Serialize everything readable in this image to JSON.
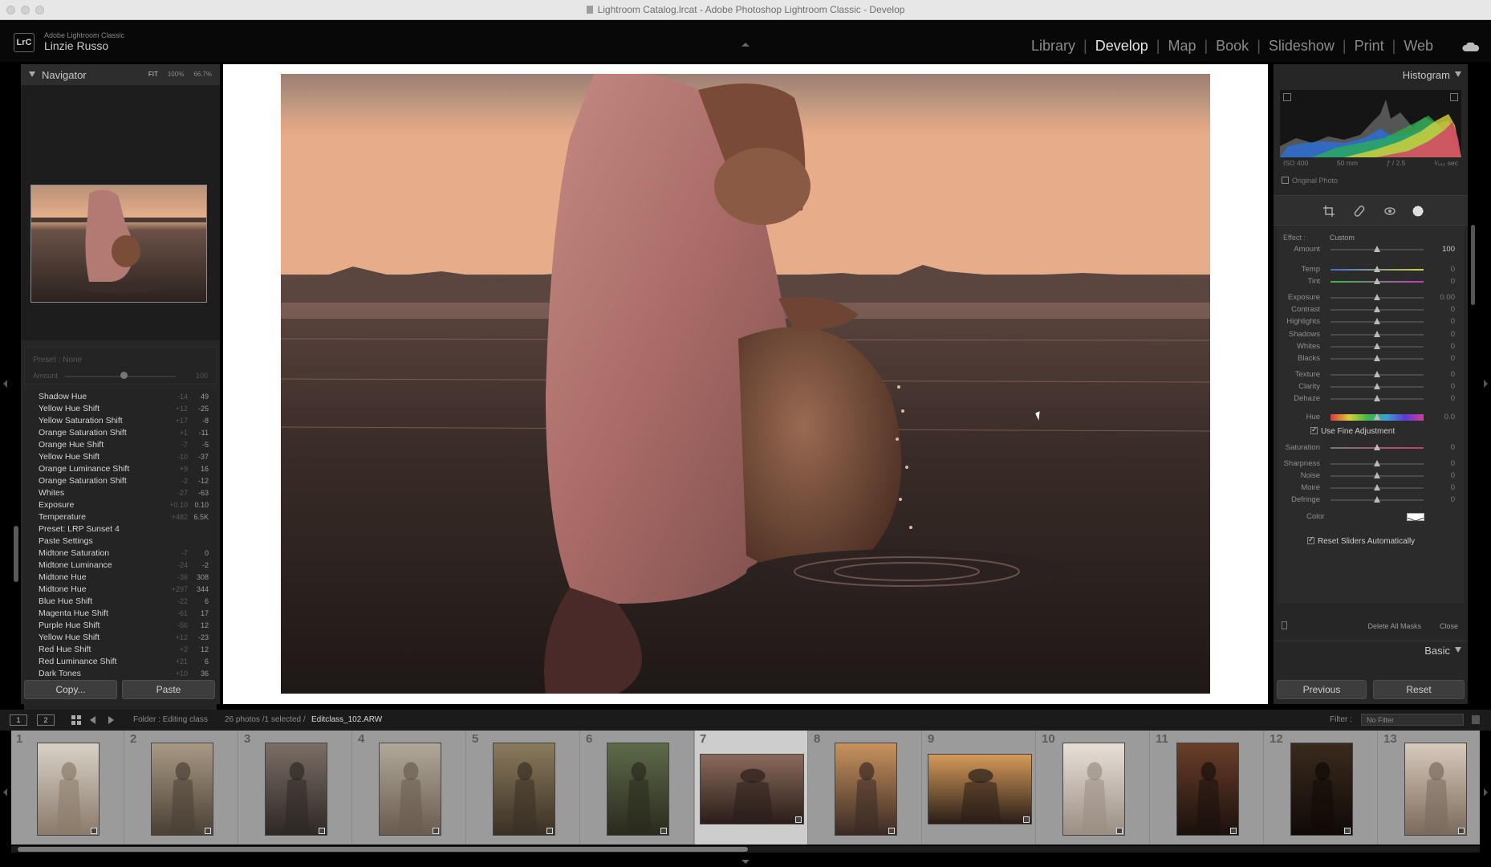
{
  "window": {
    "title": "Lightroom Catalog.lrcat - Adobe Photoshop Lightroom Classic - Develop"
  },
  "identity": {
    "logo": "LrC",
    "app_name": "Adobe Lightroom Classic",
    "user": "Linzie Russo"
  },
  "modules": [
    "Library",
    "Develop",
    "Map",
    "Book",
    "Slideshow",
    "Print",
    "Web"
  ],
  "active_module": "Develop",
  "navigator": {
    "title": "Navigator",
    "zoom_options": [
      "FIT",
      "100%",
      "66.7%"
    ],
    "active_zoom": "FIT"
  },
  "preset_box": {
    "name": "Preset : None",
    "amount_label": "Amount",
    "amount_value": "100"
  },
  "history": [
    {
      "label": "Shadow Hue",
      "delta": "-14",
      "value": "49"
    },
    {
      "label": "Yellow Hue Shift",
      "delta": "+12",
      "value": "-25"
    },
    {
      "label": "Yellow Saturation Shift",
      "delta": "+17",
      "value": "-8"
    },
    {
      "label": "Orange Saturation Shift",
      "delta": "+1",
      "value": "-11"
    },
    {
      "label": "Orange Hue Shift",
      "delta": "-7",
      "value": "-5"
    },
    {
      "label": "Yellow Hue Shift",
      "delta": "-10",
      "value": "-37"
    },
    {
      "label": "Orange Luminance Shift",
      "delta": "+9",
      "value": "16"
    },
    {
      "label": "Orange Saturation Shift",
      "delta": "-2",
      "value": "-12"
    },
    {
      "label": "Whites",
      "delta": "-27",
      "value": "-63"
    },
    {
      "label": "Exposure",
      "delta": "+0.10",
      "value": "0.10"
    },
    {
      "label": "Temperature",
      "delta": "+482",
      "value": "6.5K"
    },
    {
      "label": "Preset: LRP Sunset 4",
      "delta": "",
      "value": ""
    },
    {
      "label": "Paste Settings",
      "delta": "",
      "value": ""
    },
    {
      "label": "Midtone Saturation",
      "delta": "-7",
      "value": "0"
    },
    {
      "label": "Midtone Luminance",
      "delta": "-24",
      "value": "-2"
    },
    {
      "label": "Midtone Hue",
      "delta": "-36",
      "value": "308"
    },
    {
      "label": "Midtone Hue",
      "delta": "+297",
      "value": "344"
    },
    {
      "label": "Blue Hue Shift",
      "delta": "-22",
      "value": "6"
    },
    {
      "label": "Magenta Hue Shift",
      "delta": "-61",
      "value": "17"
    },
    {
      "label": "Purple Hue Shift",
      "delta": "-56",
      "value": "12"
    },
    {
      "label": "Yellow Hue Shift",
      "delta": "+12",
      "value": "-23"
    },
    {
      "label": "Red Hue Shift",
      "delta": "+2",
      "value": "12"
    },
    {
      "label": "Red Luminance Shift",
      "delta": "+21",
      "value": "6"
    },
    {
      "label": "Dark Tones",
      "delta": "+10",
      "value": "36"
    }
  ],
  "left_buttons": {
    "copy": "Copy...",
    "paste": "Paste"
  },
  "histogram": {
    "title": "Histogram",
    "iso": "ISO 400",
    "focal": "50 mm",
    "aperture": "ƒ / 2.5",
    "shutter": "¹⁄₁₆₀ sec",
    "original_photo": "Original Photo"
  },
  "mask": {
    "effect_label": "Effect :",
    "effect_value": "Custom",
    "sliders": [
      {
        "label": "Amount",
        "value": "100",
        "pos": 0.5
      },
      {
        "label": "Temp",
        "value": "0",
        "pos": 0.5
      },
      {
        "label": "Tint",
        "value": "0",
        "pos": 0.5
      },
      {
        "label": "Exposure",
        "value": "0.00",
        "pos": 0.5
      },
      {
        "label": "Contrast",
        "value": "0",
        "pos": 0.5
      },
      {
        "label": "Highlights",
        "value": "0",
        "pos": 0.5
      },
      {
        "label": "Shadows",
        "value": "0",
        "pos": 0.5
      },
      {
        "label": "Whites",
        "value": "0",
        "pos": 0.5
      },
      {
        "label": "Blacks",
        "value": "0",
        "pos": 0.5
      },
      {
        "label": "Texture",
        "value": "0",
        "pos": 0.5
      },
      {
        "label": "Clarity",
        "value": "0",
        "pos": 0.5
      },
      {
        "label": "Dehaze",
        "value": "0",
        "pos": 0.5
      },
      {
        "label": "Hue",
        "value": "0.0",
        "pos": 0.5
      },
      {
        "label": "Saturation",
        "value": "0",
        "pos": 0.5
      },
      {
        "label": "Sharpness",
        "value": "0",
        "pos": 0.5
      },
      {
        "label": "Noise",
        "value": "0",
        "pos": 0.5
      },
      {
        "label": "Moiré",
        "value": "0",
        "pos": 0.5
      },
      {
        "label": "Defringe",
        "value": "0",
        "pos": 0.5
      }
    ],
    "use_fine_adjustment": "Use Fine Adjustment",
    "color_label": "Color",
    "reset_sliders": "Reset Sliders Automatically",
    "delete_all": "Delete All Masks",
    "close": "Close"
  },
  "basic": {
    "title": "Basic"
  },
  "right_buttons": {
    "previous": "Previous",
    "reset": "Reset"
  },
  "filmbar": {
    "monitor_1": "1",
    "monitor_2": "2",
    "folder": "Folder : Editing class",
    "count": "26 photos /1 selected /",
    "filename": "Editclass_102.ARW",
    "filter_label": "Filter :",
    "filter_value": "No Filter"
  },
  "filmstrip": [
    {
      "num": "1",
      "orientation": "portrait",
      "selected": false
    },
    {
      "num": "2",
      "orientation": "portrait",
      "selected": false
    },
    {
      "num": "3",
      "orientation": "portrait",
      "selected": false
    },
    {
      "num": "4",
      "orientation": "portrait",
      "selected": false
    },
    {
      "num": "5",
      "orientation": "portrait",
      "selected": false
    },
    {
      "num": "6",
      "orientation": "portrait",
      "selected": false
    },
    {
      "num": "7",
      "orientation": "landscape",
      "selected": true
    },
    {
      "num": "8",
      "orientation": "portrait",
      "selected": false
    },
    {
      "num": "9",
      "orientation": "landscape",
      "selected": false
    },
    {
      "num": "10",
      "orientation": "portrait",
      "selected": false
    },
    {
      "num": "11",
      "orientation": "portrait",
      "selected": false
    },
    {
      "num": "12",
      "orientation": "portrait",
      "selected": false
    },
    {
      "num": "13",
      "orientation": "portrait",
      "selected": false
    }
  ]
}
